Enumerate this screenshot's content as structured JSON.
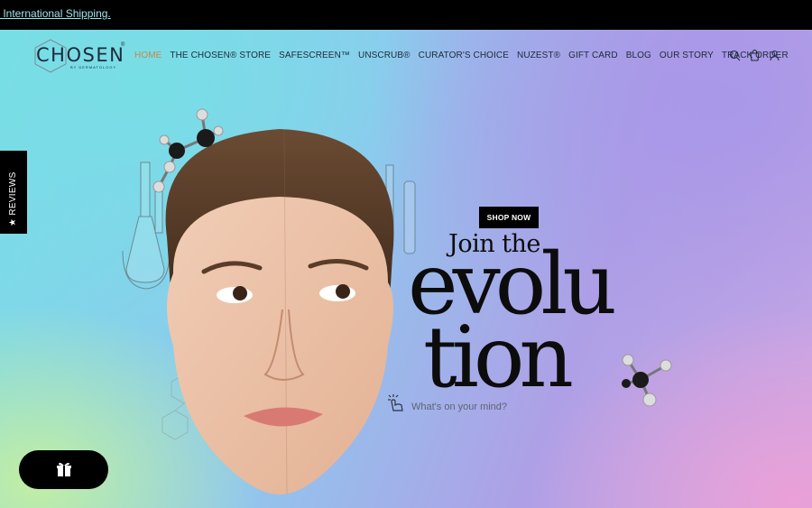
{
  "announcement": {
    "text": "r International Shipping."
  },
  "brand": {
    "name": "CHOSEN",
    "tagline": "BY DERMATOLOGY",
    "mark": "®"
  },
  "nav": {
    "items": [
      {
        "label": "HOME",
        "active": true
      },
      {
        "label": "THE CHOSEN® STORE"
      },
      {
        "label": "SAFESCREEN™"
      },
      {
        "label": "UNSCRUB®"
      },
      {
        "label": "CURATOR'S CHOICE"
      },
      {
        "label": "NUZEST®"
      },
      {
        "label": "GIFT CARD"
      },
      {
        "label": "BLOG"
      },
      {
        "label": "OUR STORY"
      },
      {
        "label": "TRACK ORDER"
      }
    ],
    "icons": [
      "search-icon",
      "cart-icon",
      "account-icon"
    ]
  },
  "reviews_tab": {
    "label": "★ REVIEWS"
  },
  "hero": {
    "cta": "SHOP NOW",
    "headline_small": "Join the",
    "headline_line1": "evolu",
    "headline_line2": "tion",
    "prompt": "What's on your mind?"
  },
  "gift_button": {
    "icon": "gift-icon"
  },
  "colors": {
    "active_nav": "#c28a4a",
    "text": "#1d2a3a",
    "black": "#000000"
  }
}
